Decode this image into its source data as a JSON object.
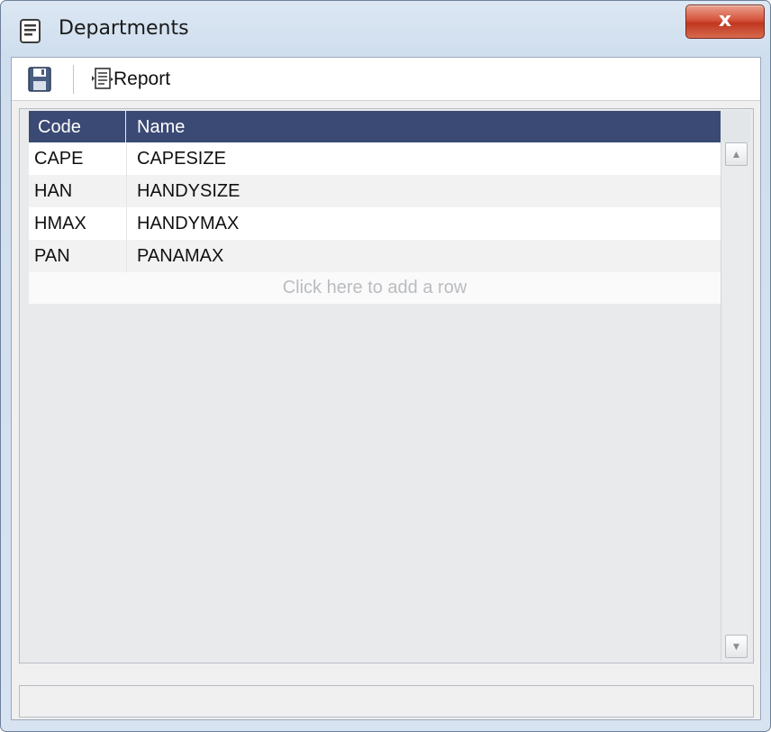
{
  "window": {
    "title": "Departments",
    "close_label": "x"
  },
  "toolbar": {
    "save_icon": "floppy-disk-icon",
    "report_icon": "report-document-icon",
    "report_label": "Report"
  },
  "grid": {
    "columns": [
      "Code",
      "Name"
    ],
    "rows": [
      {
        "code": "CAPE",
        "name": "CAPESIZE"
      },
      {
        "code": "HAN",
        "name": "HANDYSIZE"
      },
      {
        "code": "HMAX",
        "name": "HANDYMAX"
      },
      {
        "code": "PAN",
        "name": "PANAMAX"
      }
    ],
    "add_row_placeholder": "Click here to add a row"
  },
  "scrollbar": {
    "up_glyph": "▲",
    "down_glyph": "▼"
  },
  "colors": {
    "header_bg": "#3a4a74",
    "close_button": "#c0371f"
  }
}
